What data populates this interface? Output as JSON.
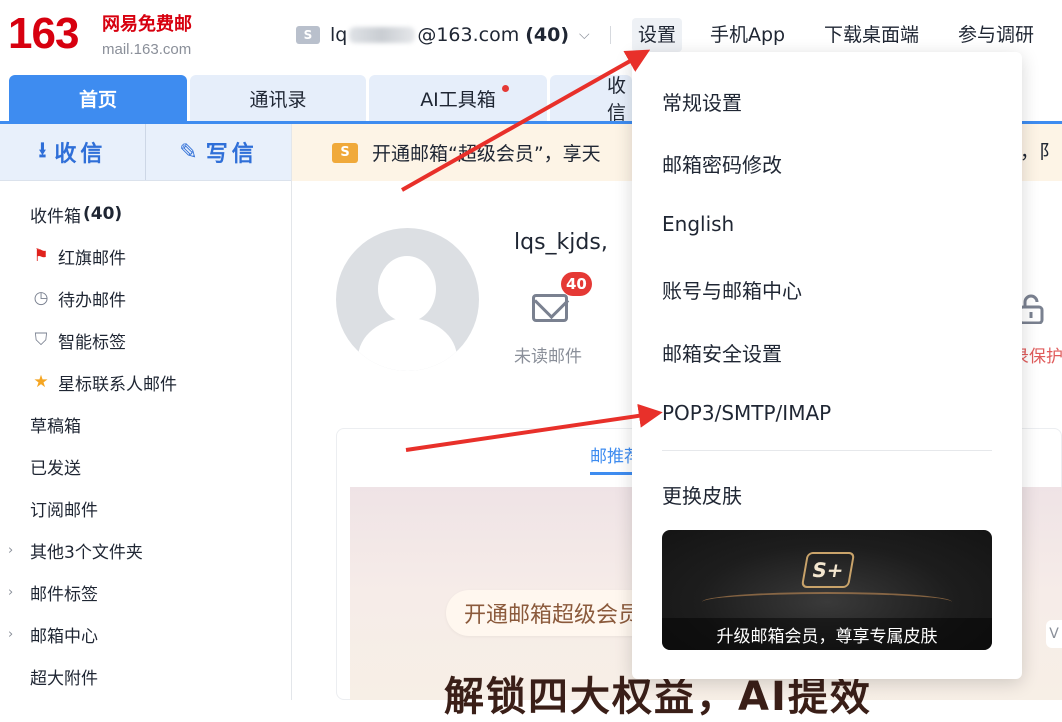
{
  "brand": {
    "logo_number": "163",
    "logo_name": "网易免费邮",
    "logo_domain": "mail.163.com",
    "color": "#d7000f"
  },
  "account": {
    "badge": "S",
    "prefix": "lq",
    "suffix": "@163.com",
    "count": "(40)"
  },
  "topnav": [
    "设置",
    "手机App",
    "下载桌面端",
    "参与调研"
  ],
  "tabs": [
    {
      "label": "首页",
      "active": true
    },
    {
      "label": "通讯录"
    },
    {
      "label": "AI工具箱",
      "dot": true
    },
    {
      "label": "收信"
    }
  ],
  "compose": {
    "receive": "收信",
    "write": "写信"
  },
  "folders": [
    {
      "label": "收件箱",
      "count": "(40)"
    },
    {
      "label": "红旗邮件",
      "icon": "flag-icon"
    },
    {
      "label": "待办邮件",
      "icon": "clock-icon"
    },
    {
      "label": "智能标签",
      "icon": "bookmark-icon"
    },
    {
      "label": "星标联系人邮件",
      "icon": "star-icon"
    },
    {
      "label": "草稿箱"
    },
    {
      "label": "已发送"
    },
    {
      "label": "订阅邮件"
    },
    {
      "label": "其他3个文件夹",
      "expandable": true
    },
    {
      "label": "邮件标签",
      "expandable": true
    },
    {
      "label": "邮箱中心",
      "expandable": true
    },
    {
      "label": "超大附件"
    }
  ],
  "notice": {
    "badge": "S",
    "text": "开通邮箱“超级会员”，享天",
    "tail": "益，阝"
  },
  "profile": {
    "username": "lqs_kjds,",
    "unread_count": "40",
    "unread_label": "未读邮件",
    "protect_label": "录保护"
  },
  "card": {
    "tab_label": "邮推荐",
    "banner_pill": "开通邮箱超级会员",
    "banner_title": "解锁四大权益，AI提效",
    "side_tag": "V"
  },
  "settings_menu": {
    "items": [
      "常规设置",
      "邮箱密码修改",
      "English",
      "账号与邮箱中心",
      "邮箱安全设置",
      "POP3/SMTP/IMAP",
      "更换皮肤"
    ],
    "skin_logo": "S+",
    "skin_caption": "升级邮箱会员，尊享专属皮肤"
  },
  "colors": {
    "accent": "#3e8cf0",
    "arrow": "#e8302a",
    "badge": "#e53935"
  }
}
